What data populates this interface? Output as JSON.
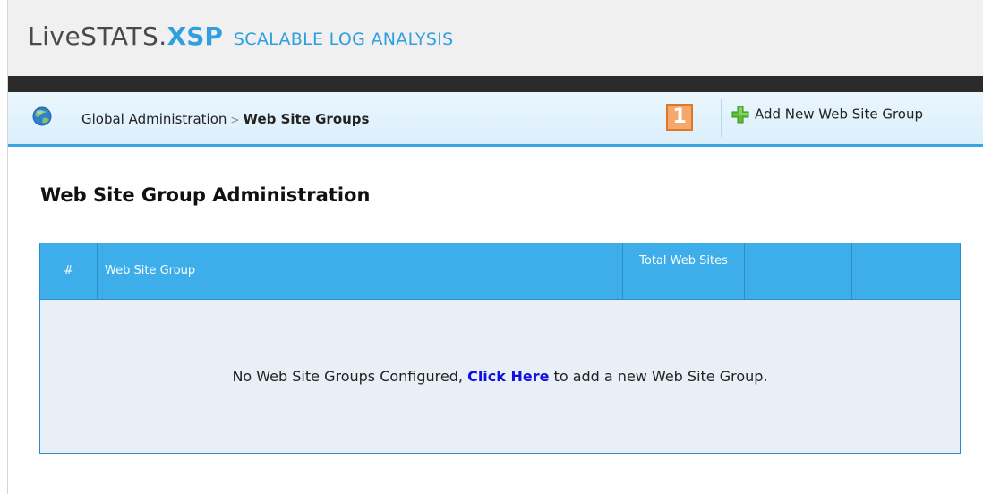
{
  "header": {
    "logo_main": "LiveSTATS.",
    "logo_accent": "XSP",
    "tagline": "SCALABLE LOG ANALYSIS"
  },
  "breadcrumb": {
    "parent": "Global Administration",
    "separator": ">",
    "current": "Web Site Groups"
  },
  "toolbar": {
    "badge_count": "1",
    "add_label": "Add New Web Site Group"
  },
  "page": {
    "title": "Web Site Group Administration"
  },
  "table": {
    "columns": [
      "#",
      "Web Site Group",
      "Total Web Sites",
      "",
      ""
    ],
    "empty": {
      "before": "No Web Site Groups Configured, ",
      "link": "Click Here",
      "after": " to add a new Web Site Group."
    }
  },
  "colors": {
    "accent": "#3daee9",
    "logo_accent": "#2f9fe0",
    "link": "#1111dd",
    "badge": "#f6a86b"
  },
  "icons": [
    "globe-icon",
    "add-plus-icon"
  ]
}
